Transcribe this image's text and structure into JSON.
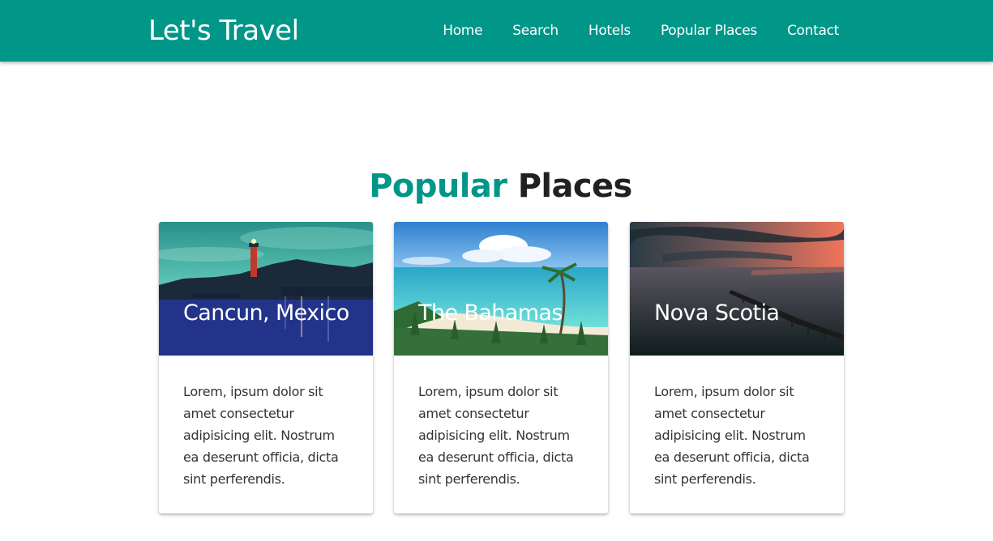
{
  "navbar": {
    "brand": "Let's Travel",
    "links": [
      "Home",
      "Search",
      "Hotels",
      "Popular Places",
      "Contact"
    ],
    "color": "#009688"
  },
  "section": {
    "title_accent": "Popular",
    "title_rest": "Places",
    "accent_color": "#009688"
  },
  "cards": [
    {
      "title": "Cancun, Mexico",
      "text": "Lorem, ipsum dolor sit amet consectetur adipisicing elit. Nostrum ea deserunt officia, dicta sint perferendis."
    },
    {
      "title": "The Bahamas",
      "text": "Lorem, ipsum dolor sit amet consectetur adipisicing elit. Nostrum ea deserunt officia, dicta sint perferendis."
    },
    {
      "title": "Nova Scotia",
      "text": "Lorem, ipsum dolor sit amet consectetur adipisicing elit. Nostrum ea deserunt officia, dicta sint perferendis."
    }
  ]
}
